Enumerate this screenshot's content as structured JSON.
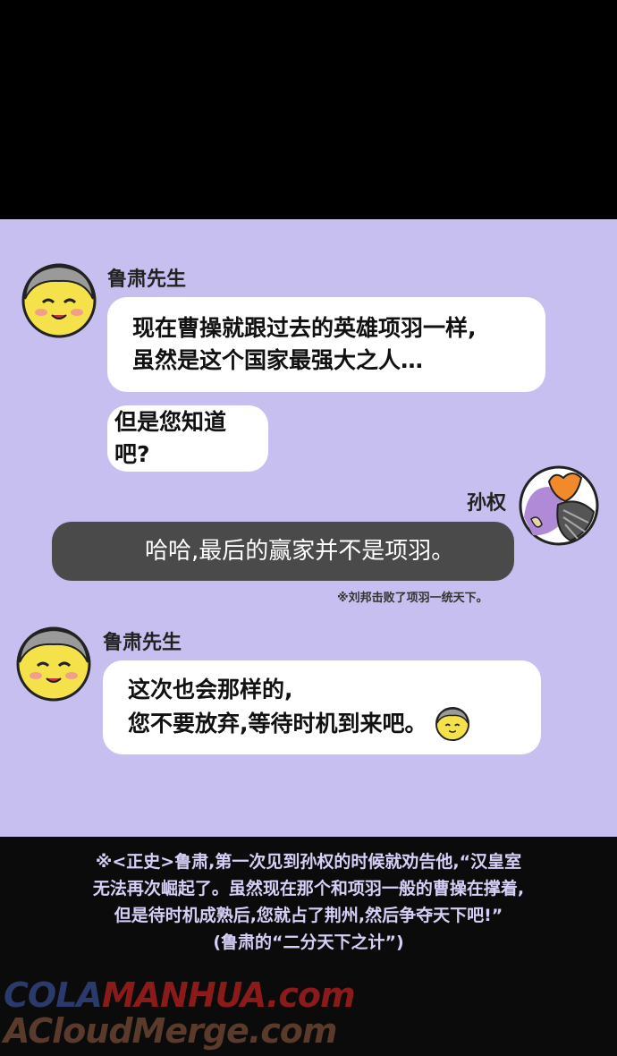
{
  "messages": [
    {
      "speaker": "鲁肃先生",
      "lines": [
        "现在曹操就跟过去的英雄项羽一样,",
        "虽然是这个国家最强大之人…"
      ]
    },
    {
      "lines": [
        "但是您知道吧?"
      ]
    },
    {
      "speaker": "孙权",
      "lines": [
        "哈哈,最后的赢家并不是项羽。"
      ],
      "note": "※刘邦击败了项羽一统天下。"
    },
    {
      "speaker": "鲁肃先生",
      "lines": [
        "这次也会那样的,",
        "您不要放弃,等待时机到来吧。"
      ]
    }
  ],
  "caption": {
    "lines": [
      "※<正史>鲁肃,第一次见到孙权的时候就劝告他,“汉皇室",
      "无法再次崛起了。虽然现在那个和项羽一般的曹操在撑着,",
      "但是待时机成熟后,您就占了荆州,然后争夺天下吧!”",
      "(鲁肃的“二分天下之计”)"
    ]
  },
  "watermark": {
    "line1_part1": "COLA",
    "line1_part2": "MANHUA.com",
    "line2": "ACloudMerge.com"
  },
  "colors": {
    "panel_bg": "#c6bfef",
    "bubble_white": "#ffffff",
    "bubble_dark": "#4a4a4a",
    "caption_text": "#d6cff7"
  }
}
